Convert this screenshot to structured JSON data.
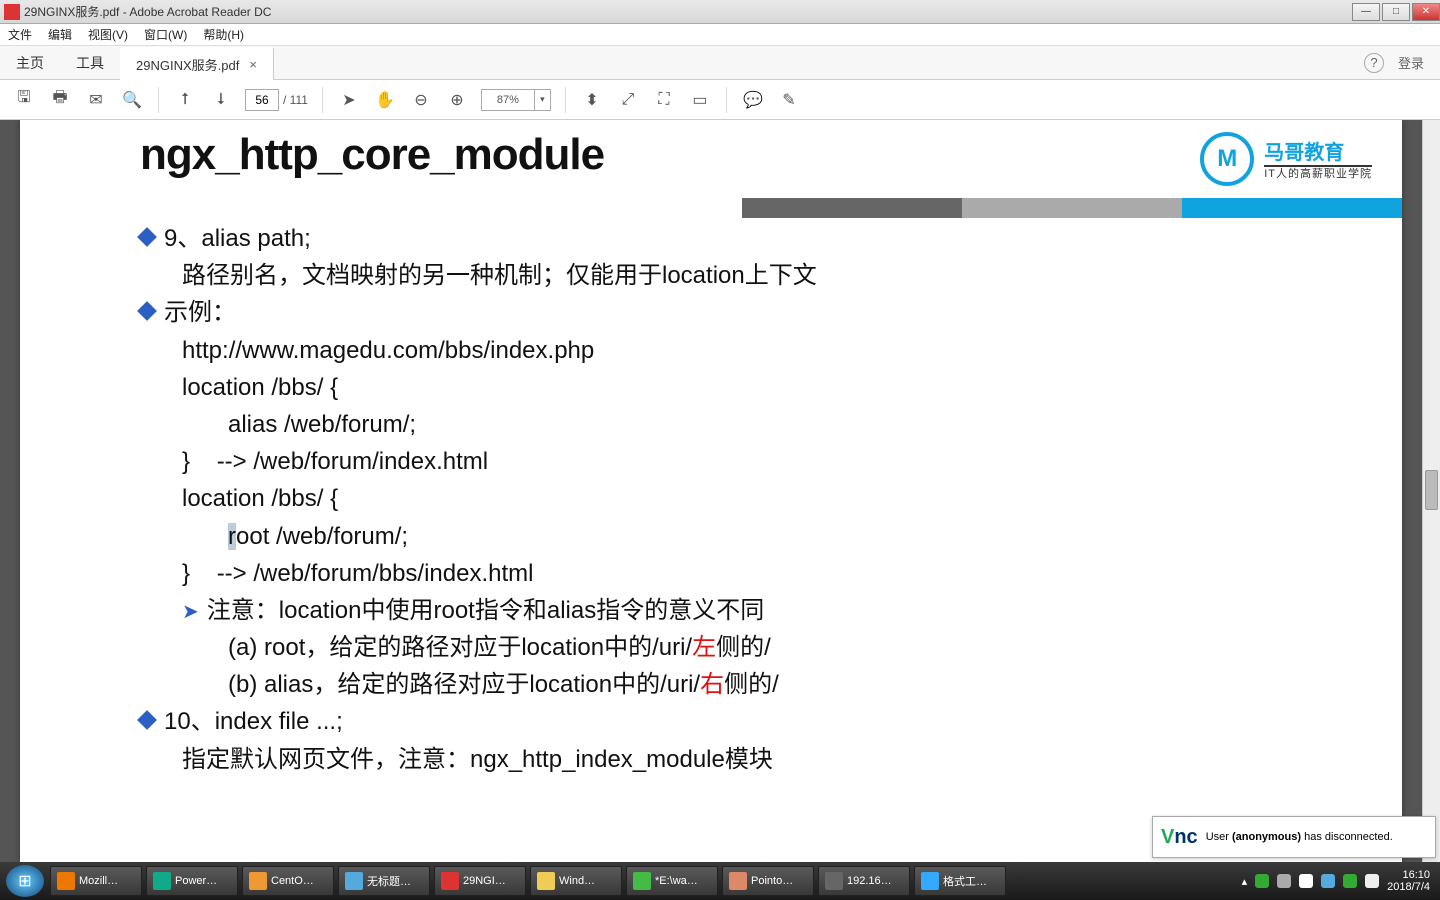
{
  "window": {
    "title": "29NGINX服务.pdf - Adobe Acrobat Reader DC"
  },
  "menu": {
    "file": "文件",
    "edit": "编辑",
    "view": "视图(V)",
    "window": "窗口(W)",
    "help": "帮助(H)"
  },
  "tabs": {
    "home": "主页",
    "tools": "工具",
    "doc": "29NGINX服务.pdf",
    "login": "登录"
  },
  "toolbar": {
    "page_current": "56",
    "page_total": "/ 111",
    "zoom": "87%"
  },
  "slide": {
    "heading": "ngx_http_core_module",
    "brand": {
      "title": "马哥教育",
      "sub": "IT人的高薪职业学院"
    },
    "l1": "9、alias path;",
    "l2": "路径别名，文档映射的另一种机制；仅能用于location上下文",
    "l3": "示例：",
    "l4": "http://www.magedu.com/bbs/index.php",
    "l5": "location /bbs/ {",
    "l6": "alias /web/forum/;",
    "l7_a": "}",
    "l7_b": "--> /web/forum/index.html",
    "l8": "location /bbs/ {",
    "l9_a": "r",
    "l9_b": "oot /web/forum/;",
    "l10_a": "}",
    "l10_b": "--> /web/forum/bbs/index.html",
    "l11": "注意：location中使用root指令和alias指令的意义不同",
    "l12_a": "(a) root，给定的路径对应于location中的/uri/",
    "l12_red": "左",
    "l12_b": "侧的/",
    "l13_a": "(b) alias，给定的路径对应于location中的/uri/",
    "l13_red": "右",
    "l13_b": "侧的/",
    "l14": "10、index file ...;",
    "l15": "指定默认网页文件，注意：ngx_http_index_module模块"
  },
  "vnc": {
    "msg_a": "User ",
    "msg_b": "(anonymous)",
    "msg_c": " has disconnected."
  },
  "taskbar": {
    "items": [
      {
        "label": "Mozill…"
      },
      {
        "label": "Power…"
      },
      {
        "label": "CentO…"
      },
      {
        "label": "无标题…"
      },
      {
        "label": "29NGI…"
      },
      {
        "label": "Wind…"
      },
      {
        "label": "*E:\\wa…"
      },
      {
        "label": "Pointo…"
      },
      {
        "label": "192.16…"
      },
      {
        "label": "格式工…"
      }
    ],
    "time": "16:10",
    "date": "2018/7/4"
  }
}
